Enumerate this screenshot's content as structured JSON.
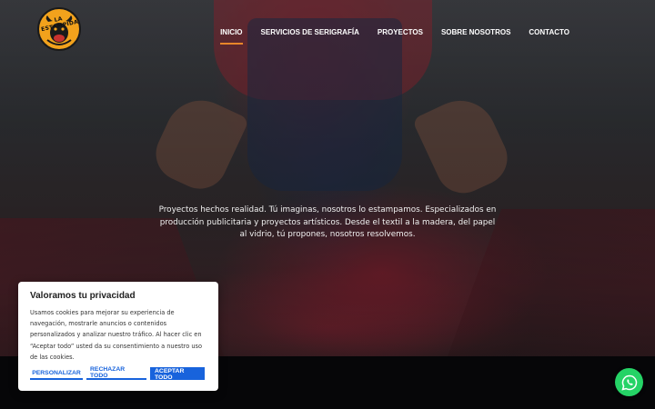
{
  "brand": {
    "logo_text": "LA ESTAMPIDA"
  },
  "nav": {
    "items": [
      {
        "label": "INICIO",
        "active": true
      },
      {
        "label": "SERVICIOS DE SERIGRAFÍA",
        "active": false
      },
      {
        "label": "PROYECTOS",
        "active": false
      },
      {
        "label": "SOBRE NOSOTROS",
        "active": false
      },
      {
        "label": "CONTACTO",
        "active": false
      }
    ],
    "active_color": "#e8862a"
  },
  "hero": {
    "text": "Proyectos hechos realidad. Tú imaginas, nosotros lo estampamos. Especializados en producción publicitaria y proyectos artísticos. Desde el textil a la madera, del papel al vidrio, tú propones, nosotros resolvemos."
  },
  "cookie": {
    "title": "Valoramos tu privacidad",
    "body": "Usamos cookies para mejorar su experiencia de navegación, mostrarle anuncios o contenidos personalizados y analizar nuestro tráfico. Al hacer clic en “Aceptar todo” usted da su consentimiento a nuestro uso de las cookies.",
    "customize_label": "PERSONALIZAR",
    "reject_label": "RECHAZAR TODO",
    "accept_label": "ACEPTAR TODO",
    "accent_color": "#1863dc"
  },
  "whatsapp": {
    "icon": "whatsapp-icon",
    "color": "#25d366"
  }
}
